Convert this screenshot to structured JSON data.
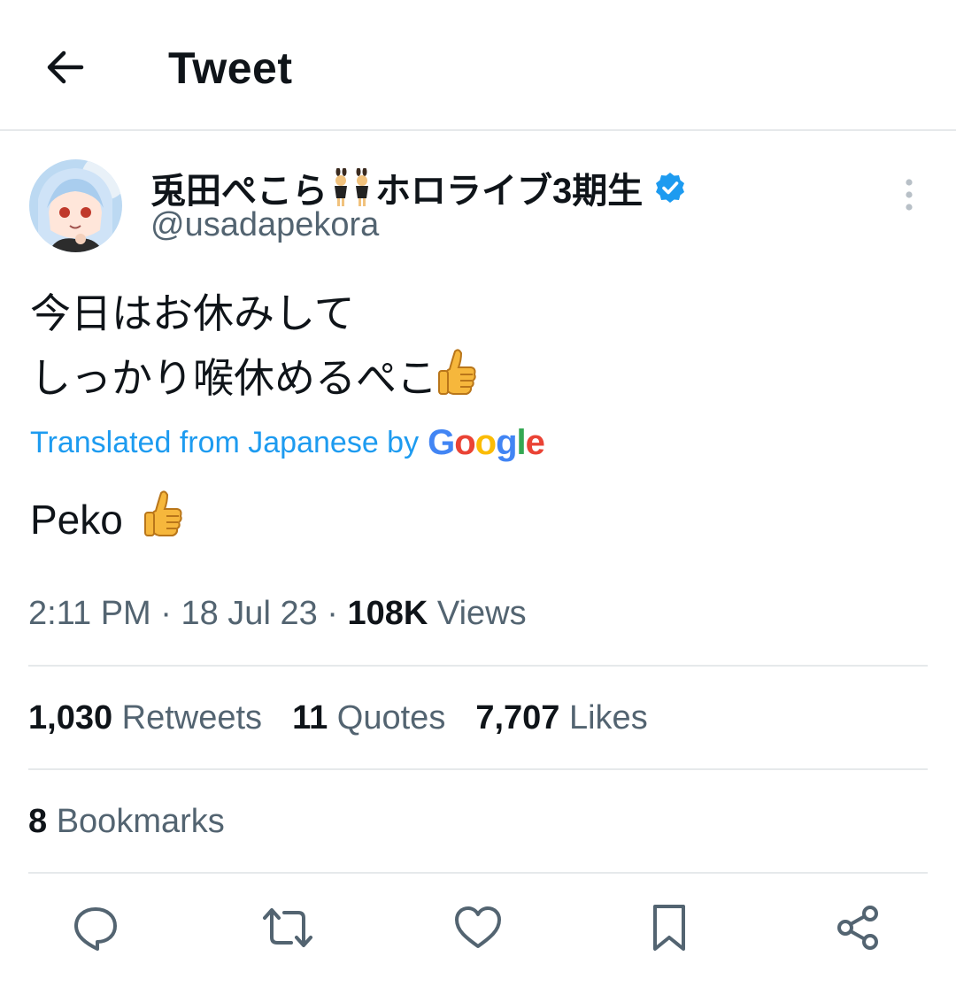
{
  "header": {
    "title": "Tweet"
  },
  "author": {
    "display_name_part1": "兎田ぺこら",
    "display_name_part2": "ホロライブ3期生",
    "handle": "@usadapekora"
  },
  "tweet": {
    "line1": "今日はお休みして",
    "line2": "しっかり喉休めるぺこ",
    "translated_label": "Translated from Japanese by",
    "translation_provider": "Google",
    "translation": "Peko"
  },
  "meta": {
    "time": "2:11 PM",
    "date": "18 Jul 23",
    "views_count": "108K",
    "views_label": "Views"
  },
  "stats": {
    "retweets_count": "1,030",
    "retweets_label": "Retweets",
    "quotes_count": "11",
    "quotes_label": "Quotes",
    "likes_count": "7,707",
    "likes_label": "Likes",
    "bookmarks_count": "8",
    "bookmarks_label": "Bookmarks"
  },
  "actions": [
    "reply-icon",
    "retweet-icon",
    "like-icon",
    "bookmark-icon",
    "share-icon"
  ],
  "colors": {
    "accent": "#1d9bf0",
    "secondary_text": "#536471",
    "divider": "#e6e9eb",
    "verified": "#1d9bf0",
    "google_blue": "#4285f4",
    "google_red": "#ea4335",
    "google_yellow": "#fbbc05",
    "google_green": "#34a853"
  }
}
